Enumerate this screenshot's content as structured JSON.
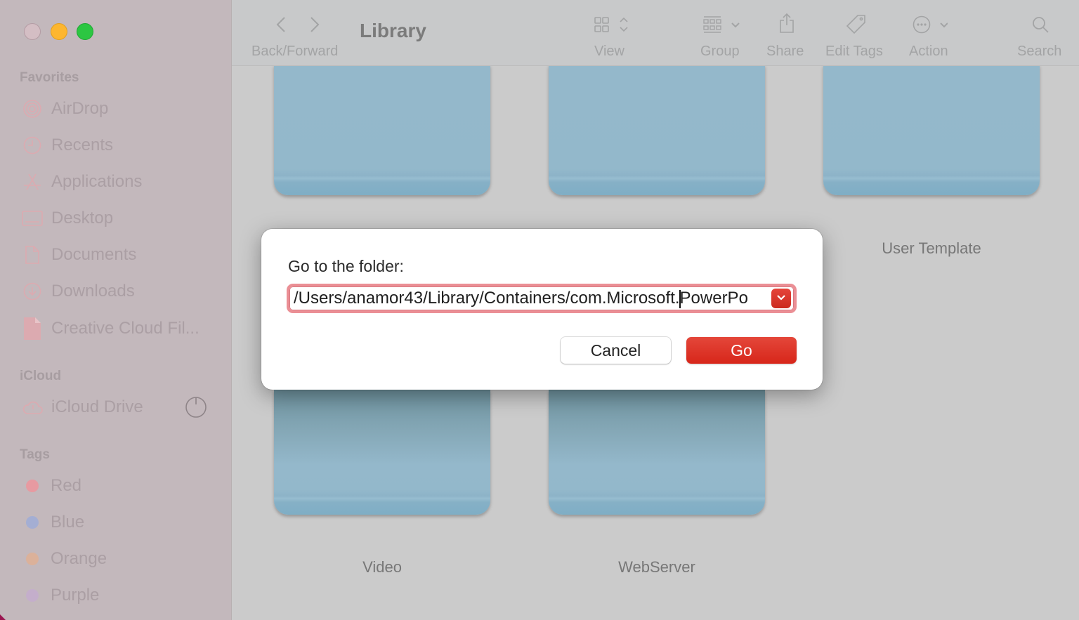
{
  "window": {
    "traffic_lights": {
      "close": "close-window",
      "minimize": "minimize-window",
      "maximize": "maximize-window"
    }
  },
  "sidebar": {
    "sections": [
      {
        "heading": "Favorites",
        "items": [
          {
            "label": "AirDrop",
            "icon": "airdrop-icon"
          },
          {
            "label": "Recents",
            "icon": "clock-icon"
          },
          {
            "label": "Applications",
            "icon": "applications-icon"
          },
          {
            "label": "Desktop",
            "icon": "desktop-icon"
          },
          {
            "label": "Documents",
            "icon": "document-icon"
          },
          {
            "label": "Downloads",
            "icon": "download-icon"
          },
          {
            "label": "Creative Cloud Fil...",
            "icon": "file-icon"
          }
        ]
      },
      {
        "heading": "iCloud",
        "items": [
          {
            "label": "iCloud Drive",
            "icon": "icloud-warning-icon",
            "status_icon": "sync-progress-icon"
          }
        ]
      },
      {
        "heading": "Tags",
        "items": [
          {
            "label": "Red",
            "color": "#e79aa1"
          },
          {
            "label": "Blue",
            "color": "#a4aed3"
          },
          {
            "label": "Orange",
            "color": "#dbb19a"
          },
          {
            "label": "Purple",
            "color": "#c4aecb"
          }
        ]
      }
    ]
  },
  "toolbar": {
    "title": "Library",
    "back_forward_label": "Back/Forward",
    "view_label": "View",
    "group_label": "Group",
    "share_label": "Share",
    "edit_tags_label": "Edit Tags",
    "action_label": "Action",
    "search_label": "Search"
  },
  "content": {
    "folders": [
      {
        "label": ""
      },
      {
        "label": ""
      },
      {
        "label": "User Template"
      },
      {
        "label": "Video"
      },
      {
        "label": "WebServer"
      }
    ]
  },
  "dialog": {
    "prompt": "Go to the folder:",
    "path_before_caret": "/Users/anamor43/Library/Containers/com.Microsoft.",
    "path_after_caret": "PowerPo",
    "cancel_label": "Cancel",
    "go_label": "Go",
    "accent_color": "#d9291d"
  }
}
